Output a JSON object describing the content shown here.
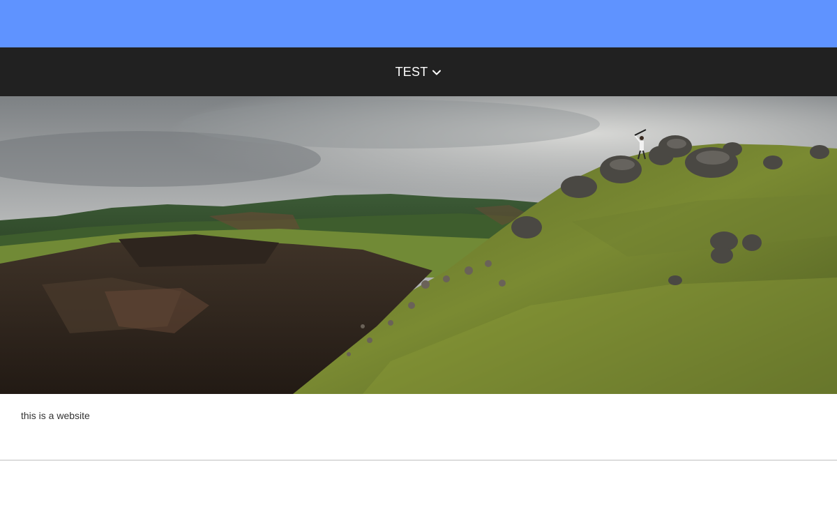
{
  "colors": {
    "banner": "#5f93ff",
    "nav_background": "#212121",
    "nav_text": "#ffffff",
    "page_background": "#ffffff",
    "body_text": "#333333"
  },
  "nav": {
    "menu_label": "TEST",
    "menu_icon": "chevron-down-icon"
  },
  "content": {
    "text": "this is a website"
  }
}
